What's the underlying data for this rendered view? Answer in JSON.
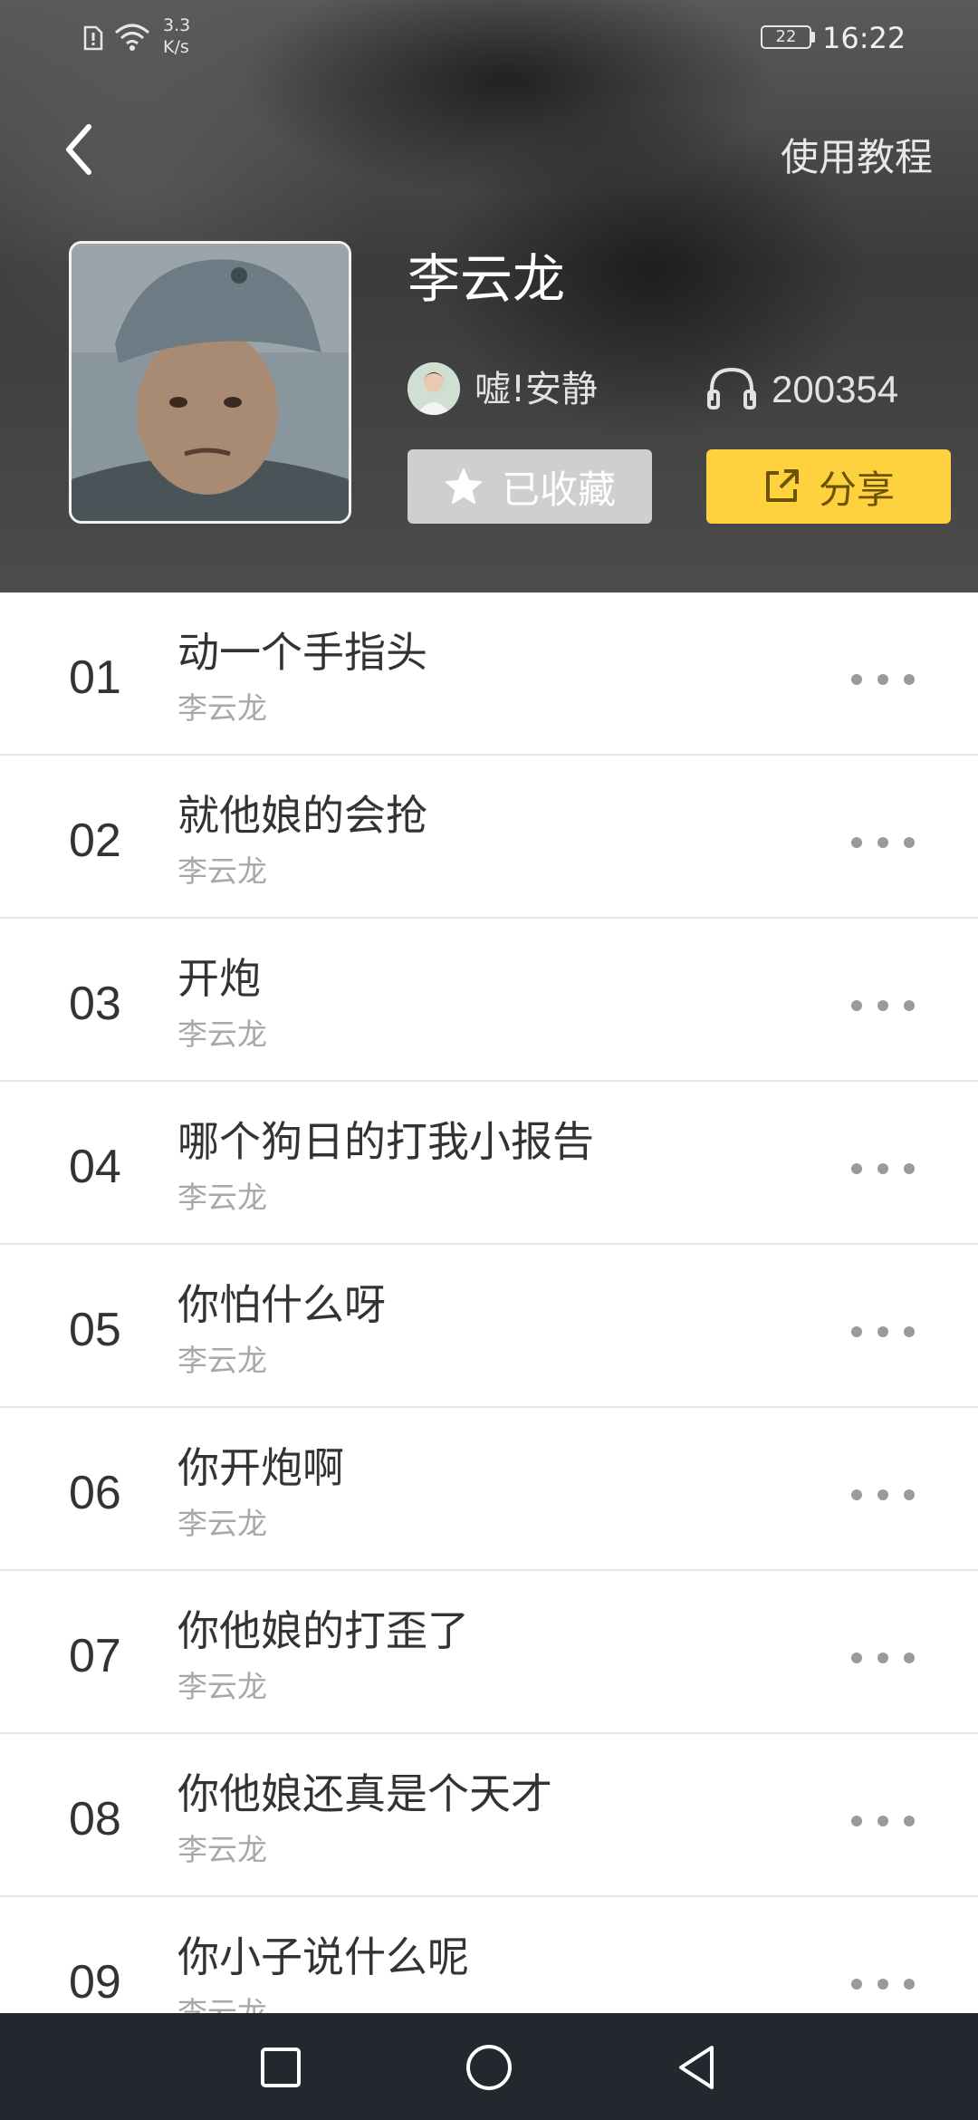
{
  "status_bar": {
    "net_speed_value": "3.3",
    "net_speed_unit": "K/s",
    "battery": "22",
    "time": "16:22"
  },
  "header": {
    "back_icon": "chevron-left-icon",
    "tutorial_label": "使用教程",
    "title": "李云龙",
    "author_name": "嘘!安静",
    "play_count": "200354",
    "favorite_label": "已收藏",
    "share_label": "分享",
    "accent_color": "#fdd23e"
  },
  "tracks": [
    {
      "num": "01",
      "title": "动一个手指头",
      "artist": "李云龙"
    },
    {
      "num": "02",
      "title": "就他娘的会抢",
      "artist": "李云龙"
    },
    {
      "num": "03",
      "title": "开炮",
      "artist": "李云龙"
    },
    {
      "num": "04",
      "title": "哪个狗日的打我小报告",
      "artist": "李云龙"
    },
    {
      "num": "05",
      "title": "你怕什么呀",
      "artist": "李云龙"
    },
    {
      "num": "06",
      "title": "你开炮啊",
      "artist": "李云龙"
    },
    {
      "num": "07",
      "title": "你他娘的打歪了",
      "artist": "李云龙"
    },
    {
      "num": "08",
      "title": "你他娘还真是个天才",
      "artist": "李云龙"
    },
    {
      "num": "09",
      "title": "你小子说什么呢",
      "artist": "李云龙"
    }
  ],
  "navbar": {
    "icons": [
      "square-recents-icon",
      "circle-home-icon",
      "triangle-back-icon"
    ]
  }
}
